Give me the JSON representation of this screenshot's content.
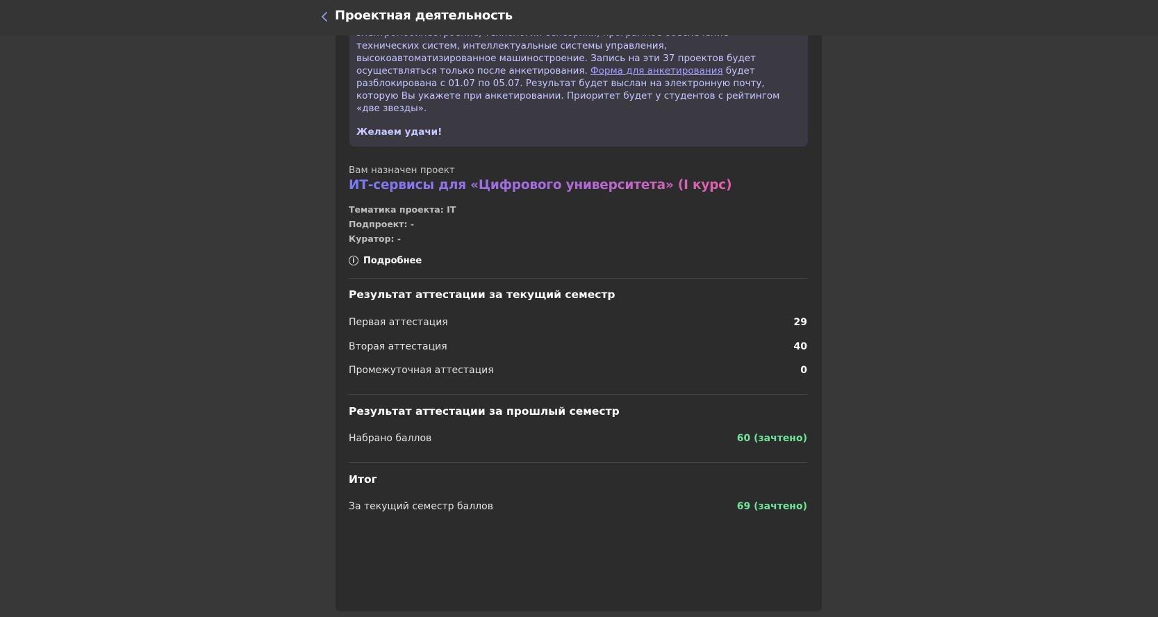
{
  "header": {
    "title": "Проектная деятельность"
  },
  "notice": {
    "line1": "электромобилестроение, технологии сенсорики, програмное обеспечение",
    "line2": "технических систем, интеллектуальные системы управления,",
    "line3": "высокоавтоматизированное машиностроение. Запись на эти 37 проектов будет",
    "line4_before": "осуществляться только после анкетирования. ",
    "line4_link": "Форма для анкетирования",
    "line4_after": " будет",
    "line5": "разблокирована с 01.07 по 05.07. Результат будет выслан на электронную почту,",
    "line6": "которую Вы укажете при анкетировании. Приоритет будет у студентов с рейтингом",
    "line7": "«две звезды».",
    "wish": "Желаем удачи!",
    "text_color": "#c6c5ff"
  },
  "project": {
    "assigned_label": "Вам назначен проект",
    "name": "ИТ-сервисы для «Цифрового университета» (I курс)",
    "topic": "Тематика проекта: IT",
    "subproject": "Подпроект: -",
    "curator": "Куратор: -",
    "more_label": "Подробнее",
    "more_icon": "info-icon"
  },
  "current_semester": {
    "title": "Результат аттестации за текущий семестр",
    "rows": [
      {
        "label": "Первая аттестация",
        "value": "29"
      },
      {
        "label": "Вторая аттестация",
        "value": "40"
      },
      {
        "label": "Промежуточная аттестация",
        "value": "0"
      }
    ]
  },
  "previous_semester": {
    "title": "Результат аттестации за прошлый семестр",
    "rows": [
      {
        "label": "Набрано баллов",
        "value": "60 (зачтено)"
      }
    ]
  },
  "total": {
    "title": "Итог",
    "rows": [
      {
        "label": "За текущий семестр баллов",
        "value": "69 (зачтено)"
      }
    ]
  },
  "colors": {
    "background": "#383838",
    "card": "#2c2c2c",
    "pass_green": "#6fe39a",
    "project_gradient_start": "#7a7af5",
    "project_gradient_end": "#e460a8"
  }
}
